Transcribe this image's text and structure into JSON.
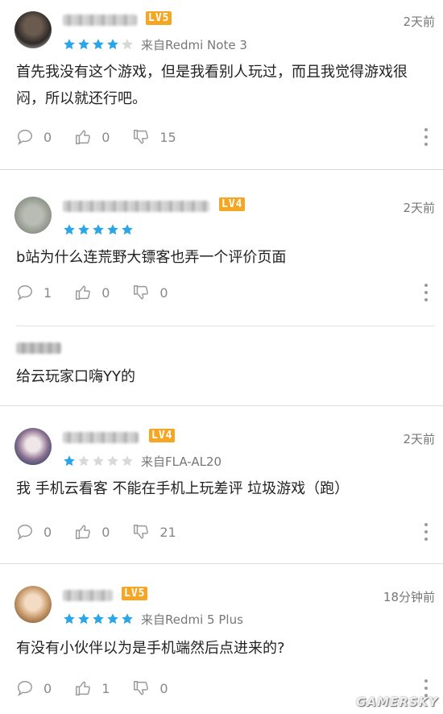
{
  "colors": {
    "star_on": "#2aa6e8",
    "star_off": "#d9d9d9",
    "level_badge": "#f5a623",
    "text_gray": "#777777"
  },
  "reviews": [
    {
      "level": "LV5",
      "time": "2天前",
      "rating": 4,
      "device": "来自Redmi Note 3",
      "text": "首先我没有这个游戏，但是我看别人玩过，而且我觉得游戏很闷，所以就还行吧。",
      "comments": "0",
      "likes": "0",
      "dislikes": "15"
    },
    {
      "level": "LV4",
      "time": "2天前",
      "rating": 5,
      "device": "",
      "text": "b站为什么连荒野大镖客也弄一个评价页面",
      "comments": "1",
      "likes": "0",
      "dislikes": "0",
      "reply": {
        "text": "给云玩家口嗨YY的"
      }
    },
    {
      "level": "LV4",
      "time": "2天前",
      "rating": 1,
      "device": "来自FLA-AL20",
      "text": "我 手机云看客 不能在手机上玩差评 垃圾游戏（跑）",
      "comments": "0",
      "likes": "0",
      "dislikes": "21"
    },
    {
      "level": "LV5",
      "time": "18分钟前",
      "rating": 5,
      "device": "来自Redmi 5 Plus",
      "text": "有没有小伙伴以为是手机端然后点进来的?",
      "comments": "0",
      "likes": "1",
      "dislikes": "0"
    }
  ],
  "watermark": "GAMERSKY"
}
